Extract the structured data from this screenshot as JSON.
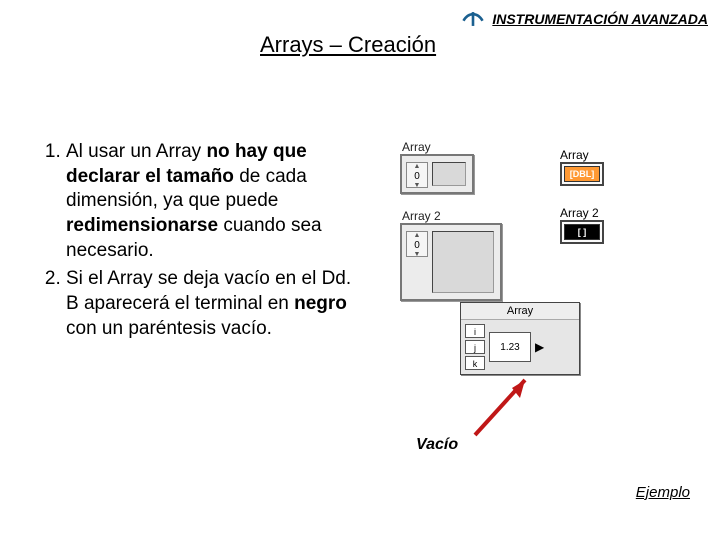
{
  "header": {
    "brand": "INSTRUMENTACIÓN AVANZADA"
  },
  "title": "Arrays – Creación",
  "list": {
    "item1_a": "Al usar un Array ",
    "item1_b": "no hay que declarar el tamaño",
    "item1_c": " de cada dimensión, ya que puede ",
    "item1_d": "redimensionarse",
    "item1_e": " cuando sea necesario.",
    "item2_a": "Si el Array se deja vacío en el Dd. B aparecerá el terminal en ",
    "item2_b": "negro",
    "item2_c": " con un paréntesis vacío."
  },
  "widgets": {
    "array1_label": "Array",
    "array1_index": "0",
    "array2_label": "Array 2",
    "array2_index": "0"
  },
  "terminals": {
    "t1_label": "Array",
    "t1_text": "[DBL]",
    "t2_label": "Array 2",
    "t2_text": " "
  },
  "palette": {
    "title": "Array",
    "i": "i",
    "j": "j",
    "k": "k",
    "num": "1.23",
    "arrow": "▶"
  },
  "vacio": "Vacío",
  "ejemplo": "Ejemplo"
}
